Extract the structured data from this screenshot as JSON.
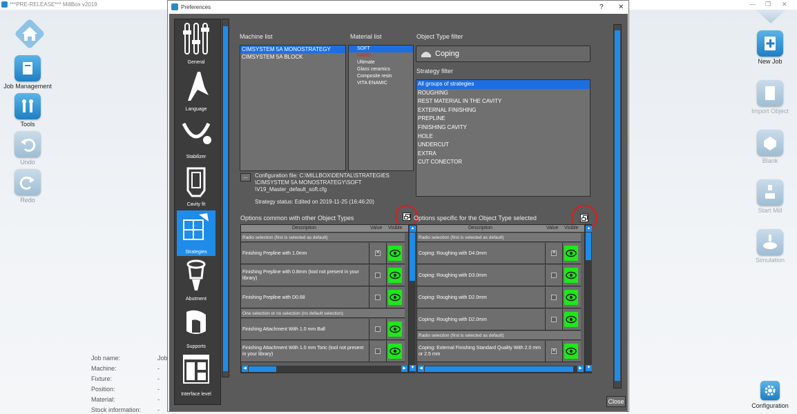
{
  "app": {
    "title": "***PRE-RELEASE*** MillBox v2019"
  },
  "desktop": {
    "left_tools": [
      {
        "label": "Job Management",
        "icon": "folder-icon"
      },
      {
        "label": "Tools",
        "icon": "tools-icon"
      },
      {
        "label": "Undo",
        "icon": "undo-icon"
      },
      {
        "label": "Redo",
        "icon": "redo-icon"
      }
    ],
    "right_tools": [
      {
        "label": "New Job",
        "icon": "new-job-icon"
      },
      {
        "label": "Import Object",
        "icon": "import-object-icon"
      },
      {
        "label": "Blank",
        "icon": "blank-icon"
      },
      {
        "label": "Start Mill",
        "icon": "start-mill-icon"
      },
      {
        "label": "Simulation",
        "icon": "simulation-icon"
      },
      {
        "label": "Configuration",
        "icon": "gear-icon"
      }
    ],
    "job_info": [
      {
        "label": "Job name:",
        "value": "Job"
      },
      {
        "label": "Machine:",
        "value": "-"
      },
      {
        "label": "Fixture:",
        "value": "-"
      },
      {
        "label": "Position:",
        "value": "-"
      },
      {
        "label": "Material:",
        "value": "-"
      },
      {
        "label": "Stock information:",
        "value": "-"
      }
    ]
  },
  "dialog": {
    "title": "Preferences",
    "help": "?",
    "close_x": "✕",
    "sidebar": [
      {
        "label": "General"
      },
      {
        "label": "Language"
      },
      {
        "label": "Stabilizer"
      },
      {
        "label": "Cavity fit"
      },
      {
        "label": "Strategies"
      },
      {
        "label": "Abutment"
      },
      {
        "label": "Supports"
      },
      {
        "label": "Interface level"
      }
    ],
    "machine_list": {
      "title": "Machine list",
      "items": [
        "CIMSYSTEM 5A MONOSTRATEGY",
        "CIMSYSTEM 5A BLOCK"
      ]
    },
    "material_list": {
      "title": "Material list",
      "items": [
        "SOFT",
        "HARD",
        "Ultimate",
        "Glass ceramics",
        "Composite resin",
        "VITA ENAMIC"
      ]
    },
    "object_type_filter": {
      "title": "Object Type filter",
      "value": "Coping"
    },
    "strategy_filter": {
      "title": "Strategy filter",
      "items": [
        "All groups of strategies",
        "ROUGHING",
        "REST MATERIAL IN THE CAVITY",
        "EXTERNAL FINISHING",
        "PREPLINE",
        "FINISHING CAVITY",
        "HOLE",
        "UNDERCUT",
        "EXTRA",
        "CUT CONECTOR"
      ]
    },
    "config": {
      "button": "...",
      "line1": "Configuration file: C:\\MILLBOX\\DENTAL\\STRATEGIES",
      "line2": "\\CIMSYSTEM 5A MONOSTRATEGY\\SOFT",
      "line3": "\\V19_Master_default_soft.cfg",
      "status": "Strategy status: Edited on 2019-11-25 (16:46:20)"
    },
    "common": {
      "title": "Options common with other Object Types",
      "headers": {
        "description": "Description",
        "value": "Value",
        "visible": "Visible"
      },
      "sec1": "Radio selection (first is selected as default)",
      "rows": [
        {
          "desc": "Finishing Prepline with 1.0mm",
          "checked": "✕"
        },
        {
          "desc": "Finishing Prepline with 0.8mm (tool not present in your library)",
          "checked": ""
        },
        {
          "desc": "Finishing Prepline with D0.68",
          "checked": ""
        }
      ],
      "sec2": "One selection or no selection (no default selection)",
      "rows2": [
        {
          "desc": "Finishing Attachment With 1.0 mm Ball",
          "checked": ""
        },
        {
          "desc": "Finishing Attachment With 1.0 mm Toric (tool not present in your library)",
          "checked": ""
        }
      ]
    },
    "specific": {
      "title": "Options specific for the Object Type selected",
      "headers": {
        "description": "Description",
        "value": "Value",
        "visible": "Visible"
      },
      "sec1": "Radio selection (first is selected as default)",
      "rows": [
        {
          "desc": "Coping: Roughing with D4.0mm",
          "checked": "✕"
        },
        {
          "desc": "Coping: Roughing with D3.0mm",
          "checked": ""
        },
        {
          "desc": "Coping: Roughing with D2.0mm",
          "checked": ""
        },
        {
          "desc": "Coping: Roughing with D2.0mm",
          "checked": ""
        }
      ],
      "sec2": "Radio selection (first is selected as default)",
      "rows2": [
        {
          "desc": "Coping: External Finishing Standard Quality With 2.0 mm or 2.5 mm",
          "checked": "✕"
        }
      ]
    },
    "close_button": "Close"
  }
}
